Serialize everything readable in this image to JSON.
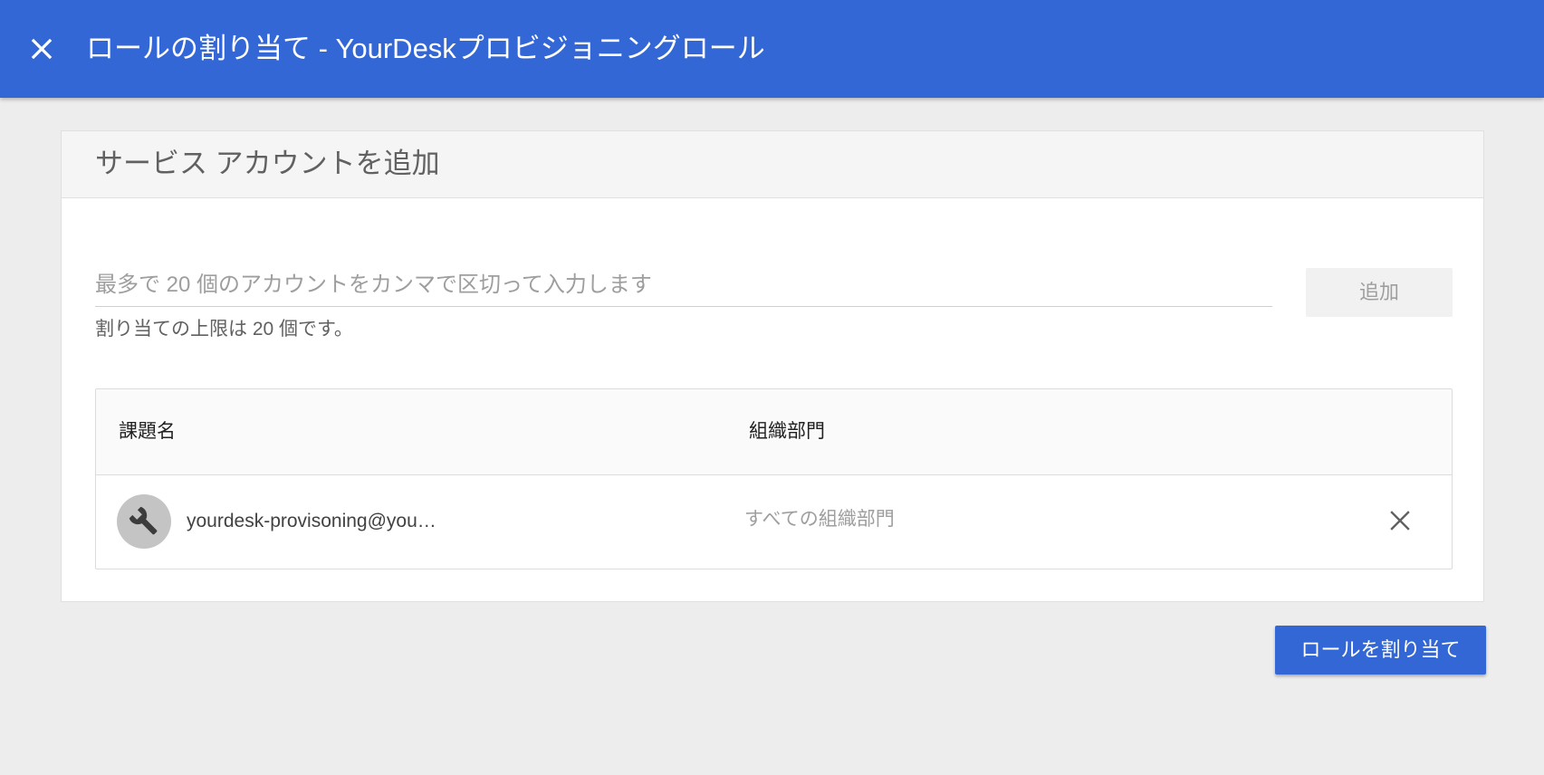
{
  "header": {
    "title": "ロールの割り当て - YourDeskプロビジョニングロール",
    "close_icon": "close-icon",
    "background_color": "#3367d6"
  },
  "card": {
    "heading": "サービス アカウントを追加",
    "input": {
      "value": "",
      "placeholder": "最多で 20 個のアカウントをカンマで区切って入力します"
    },
    "helper_text": "割り当ての上限は 20 個です。",
    "add_button_label": "追加",
    "table": {
      "columns": [
        "課題名",
        "組織部門"
      ],
      "rows": [
        {
          "avatar_icon": "wrench-icon",
          "name": "yourdesk-provisoning@you…",
          "org_unit": "すべての組織部門",
          "remove_icon": "close-icon"
        }
      ]
    }
  },
  "footer": {
    "assign_button_label": "ロールを割り当て",
    "accent_color": "#3367d6"
  }
}
